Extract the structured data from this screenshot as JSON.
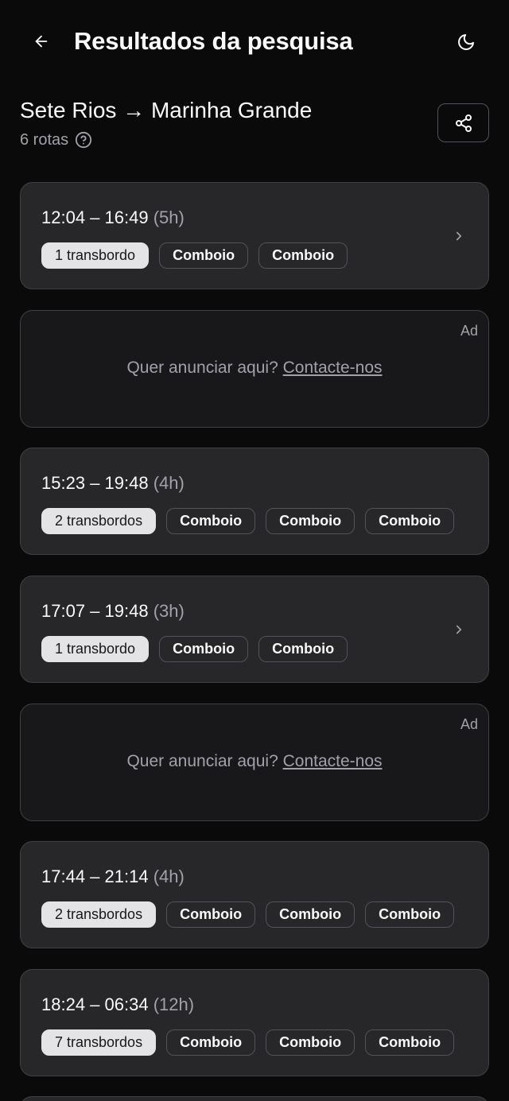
{
  "header": {
    "title": "Resultados da pesquisa",
    "back_icon": "arrow-left-icon",
    "theme_icon": "moon-icon"
  },
  "route": {
    "title": "Sete Rios → Marinha Grande",
    "count": "6 rotas",
    "help_icon": "question-circle-icon",
    "share_icon": "share-icon"
  },
  "ads": [
    {
      "label": "Ad",
      "text": "Quer anunciar aqui?",
      "link": "Contacte-nos"
    },
    {
      "label": "Ad",
      "text": "Quer anunciar aqui?",
      "link": "Contacte-nos"
    }
  ],
  "results": [
    {
      "time": "12:04 – 16:49",
      "duration": "(5h)",
      "transfers": "1 transbordo",
      "modes": [
        "Comboio",
        "Comboio"
      ],
      "chevron": true
    },
    {
      "time": "15:23 – 19:48",
      "duration": "(4h)",
      "transfers": "2 transbordos",
      "modes": [
        "Comboio",
        "Comboio",
        "Comboio"
      ],
      "chevron": false
    },
    {
      "time": "17:07 – 19:48",
      "duration": "(3h)",
      "transfers": "1 transbordo",
      "modes": [
        "Comboio",
        "Comboio"
      ],
      "chevron": true
    },
    {
      "time": "17:44 – 21:14",
      "duration": "(4h)",
      "transfers": "2 transbordos",
      "modes": [
        "Comboio",
        "Comboio",
        "Comboio"
      ],
      "chevron": false
    },
    {
      "time": "18:24 – 06:34",
      "duration": "(12h)",
      "transfers": "7 transbordos",
      "modes": [
        "Comboio",
        "Comboio",
        "Comboio"
      ],
      "chevron": false
    }
  ],
  "colors": {
    "background": "#0a0a0b",
    "card": "#27272a",
    "ad_card": "#18181b",
    "border": "#3f3f46",
    "muted_text": "#a1a1aa",
    "badge_light": "#e4e4e7"
  }
}
